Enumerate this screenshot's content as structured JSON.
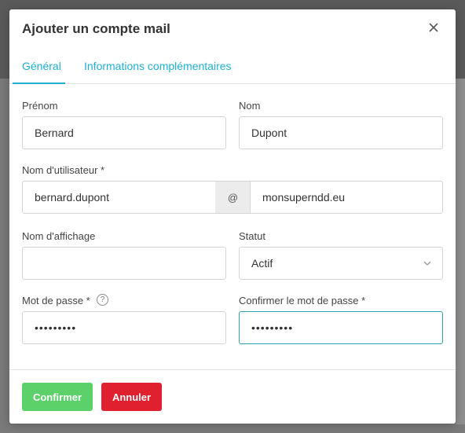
{
  "modal": {
    "title": "Ajouter un compte mail"
  },
  "tabs": [
    {
      "label": "Général",
      "active": true
    },
    {
      "label": "Informations complémentaires",
      "active": false
    }
  ],
  "form": {
    "first_name": {
      "label": "Prénom",
      "value": "Bernard"
    },
    "last_name": {
      "label": "Nom",
      "value": "Dupont"
    },
    "username": {
      "label": "Nom d'utilisateur *",
      "value": "bernard.dupont",
      "separator": "@",
      "domain": "monsuperndd.eu"
    },
    "display_name": {
      "label": "Nom d'affichage",
      "value": ""
    },
    "status": {
      "label": "Statut",
      "value": "Actif"
    },
    "password": {
      "label": "Mot de passe *",
      "value": "•••••••••",
      "help": "?"
    },
    "password_confirm": {
      "label": "Confirmer le mot de passe *",
      "value": "•••••••••"
    }
  },
  "footer": {
    "confirm_label": "Confirmer",
    "cancel_label": "Annuler"
  },
  "colors": {
    "accent": "#1fb0d4",
    "confirm": "#5cd069",
    "cancel": "#e0202f",
    "focus_border": "#2ea6a9"
  },
  "icons": {
    "close": "close-icon",
    "chevron": "chevron-down-icon",
    "help": "help-icon"
  }
}
